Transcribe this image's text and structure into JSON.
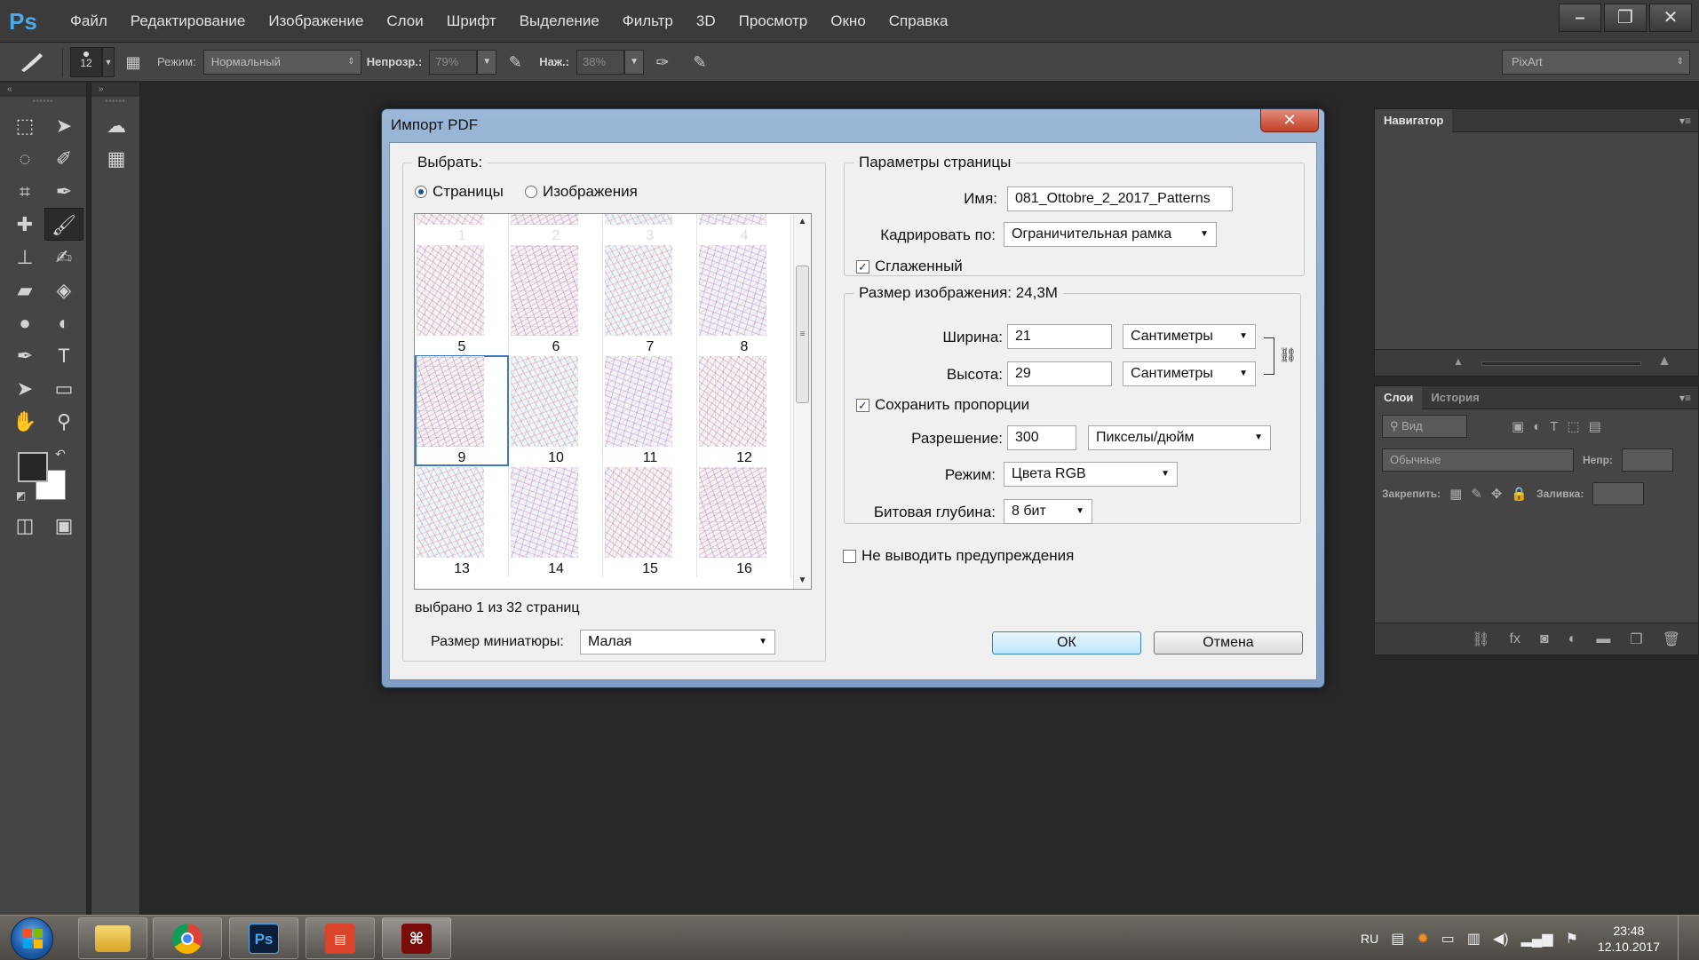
{
  "app": {
    "logo": "Ps",
    "menu": [
      "Файл",
      "Редактирование",
      "Изображение",
      "Слои",
      "Шрифт",
      "Выделение",
      "Фильтр",
      "3D",
      "Просмотр",
      "Окно",
      "Справка"
    ],
    "window_controls": [
      "–",
      "❐",
      "✕"
    ]
  },
  "options_bar": {
    "brush_size": "12",
    "mode_label": "Режим:",
    "mode_value": "Нормальный",
    "opacity_label": "Непрозр.:",
    "opacity_value": "79%",
    "pressure_label": "Наж.:",
    "pressure_value": "38%",
    "workspace": "PixArt"
  },
  "tools": {
    "collapse_left": "«",
    "collapse_right": "»",
    "icons": [
      "rect-marquee-icon",
      "move-icon",
      "lasso-icon",
      "quick-select-icon",
      "crop-icon",
      "eyedropper-icon",
      "healing-icon",
      "brush-icon",
      "stamp-icon",
      "history-brush-icon",
      "eraser-icon",
      "paint-bucket-icon",
      "blur-icon",
      "dodge-icon",
      "pen-icon",
      "type-icon",
      "path-select-icon",
      "rectangle-shape-icon",
      "hand-icon",
      "zoom-icon"
    ]
  },
  "navigator_panel": {
    "tab": "Навигатор"
  },
  "layers_panel": {
    "tabs": [
      "Слои",
      "История"
    ],
    "filter_label": "Вид",
    "blend_mode": "Обычные",
    "opacity_label": "Непр:",
    "lock_label": "Закрепить:",
    "fill_label": "Заливка:"
  },
  "dialog": {
    "title": "Импорт PDF",
    "close": "✕",
    "select_group": {
      "legend": "Выбрать:",
      "radio_pages": "Страницы",
      "radio_images": "Изображения",
      "selected": "pages"
    },
    "thumbnails": {
      "top_row": [
        "1",
        "2",
        "3",
        "4"
      ],
      "rows": [
        [
          "5",
          "6",
          "7",
          "8"
        ],
        [
          "9",
          "10",
          "11",
          "12"
        ],
        [
          "13",
          "14",
          "15",
          "16"
        ]
      ],
      "selected_page": "9"
    },
    "selection_status": "выбрано 1 из 32 страниц",
    "thumb_size_label": "Размер миниатюры:",
    "thumb_size_value": "Малая",
    "page_params": {
      "legend": "Параметры страницы",
      "name_label": "Имя:",
      "name_value": "081_Ottobre_2_2017_Patterns",
      "crop_label": "Кадрировать по:",
      "crop_value": "Ограничительная рамка",
      "antialias_label": "Сглаженный",
      "antialias_checked": true
    },
    "image_size": {
      "legend": "Размер изображения: 24,3M",
      "width_label": "Ширина:",
      "width_value": "21",
      "width_unit": "Сантиметры",
      "height_label": "Высота:",
      "height_value": "29",
      "height_unit": "Сантиметры",
      "constrain_label": "Сохранить пропорции",
      "constrain_checked": true,
      "resolution_label": "Разрешение:",
      "resolution_value": "300",
      "resolution_unit": "Пикселы/дюйм",
      "mode_label": "Режим:",
      "mode_value": "Цвета RGB",
      "bitdepth_label": "Битовая глубина:",
      "bitdepth_value": "8 бит"
    },
    "suppress_warnings_label": "Не выводить предупреждения",
    "suppress_warnings_checked": false,
    "ok_label": "ОК",
    "cancel_label": "Отмена"
  },
  "taskbar": {
    "apps": [
      "explorer-icon",
      "chrome-icon",
      "photoshop-icon",
      "reader-icon",
      "acrobat-icon"
    ],
    "ps_text": "Ps",
    "lang": "RU",
    "time": "23:48",
    "date": "12.10.2017"
  }
}
